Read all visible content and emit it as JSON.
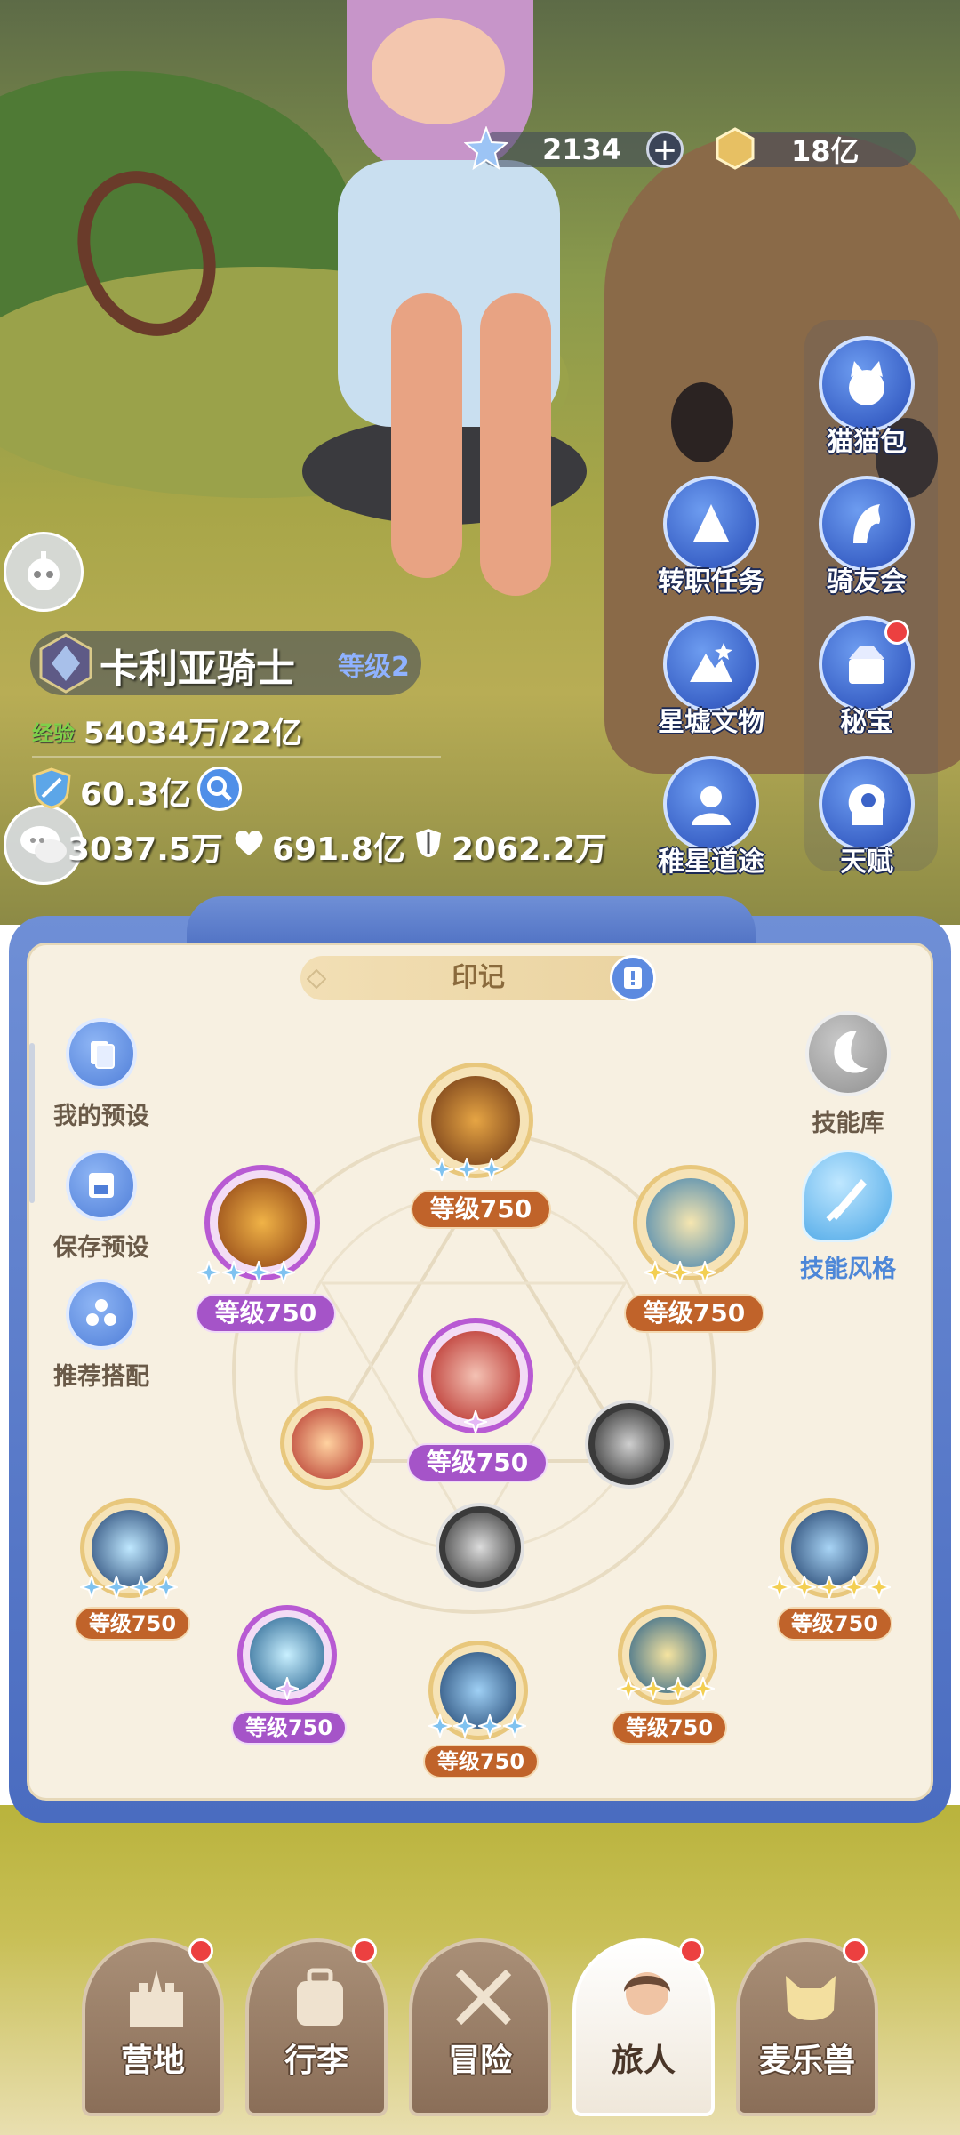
{
  "currency": {
    "stars": "2134",
    "gold": "18亿"
  },
  "right_menu": [
    {
      "label": "猫猫包",
      "badge": false
    },
    {
      "label": "转职任务",
      "badge": false
    },
    {
      "label": "骑友会",
      "badge": false
    },
    {
      "label": "星墟文物",
      "badge": false
    },
    {
      "label": "秘宝",
      "badge": true
    },
    {
      "label": "稚星道途",
      "badge": false
    },
    {
      "label": "天赋",
      "badge": false
    }
  ],
  "player": {
    "class_name": "卡利亚骑士",
    "level": "等级2",
    "exp_label": "经验",
    "exp_value": "54034万/22亿",
    "power": "60.3亿",
    "attack": "3037.5万",
    "hp": "691.8亿",
    "defense": "2062.2万"
  },
  "panel": {
    "title": "印记",
    "left_buttons": [
      "我的预设",
      "保存预设",
      "推荐搭配"
    ],
    "right_buttons": [
      "技能库",
      "技能风格"
    ],
    "level_text": "等级750"
  },
  "bottom_nav": [
    {
      "label": "营地",
      "badge": true,
      "active": false
    },
    {
      "label": "行李",
      "badge": true,
      "active": false
    },
    {
      "label": "冒险",
      "badge": false,
      "active": false
    },
    {
      "label": "旅人",
      "badge": true,
      "active": true
    },
    {
      "label": "麦乐兽",
      "badge": true,
      "active": false
    }
  ],
  "colors": {
    "accent_blue": "#4a6cc0",
    "panel_bg": "#f7f0e1",
    "level_orange": "#c0632a",
    "level_purple": "#a554c8",
    "badge_red": "#ec4040"
  }
}
